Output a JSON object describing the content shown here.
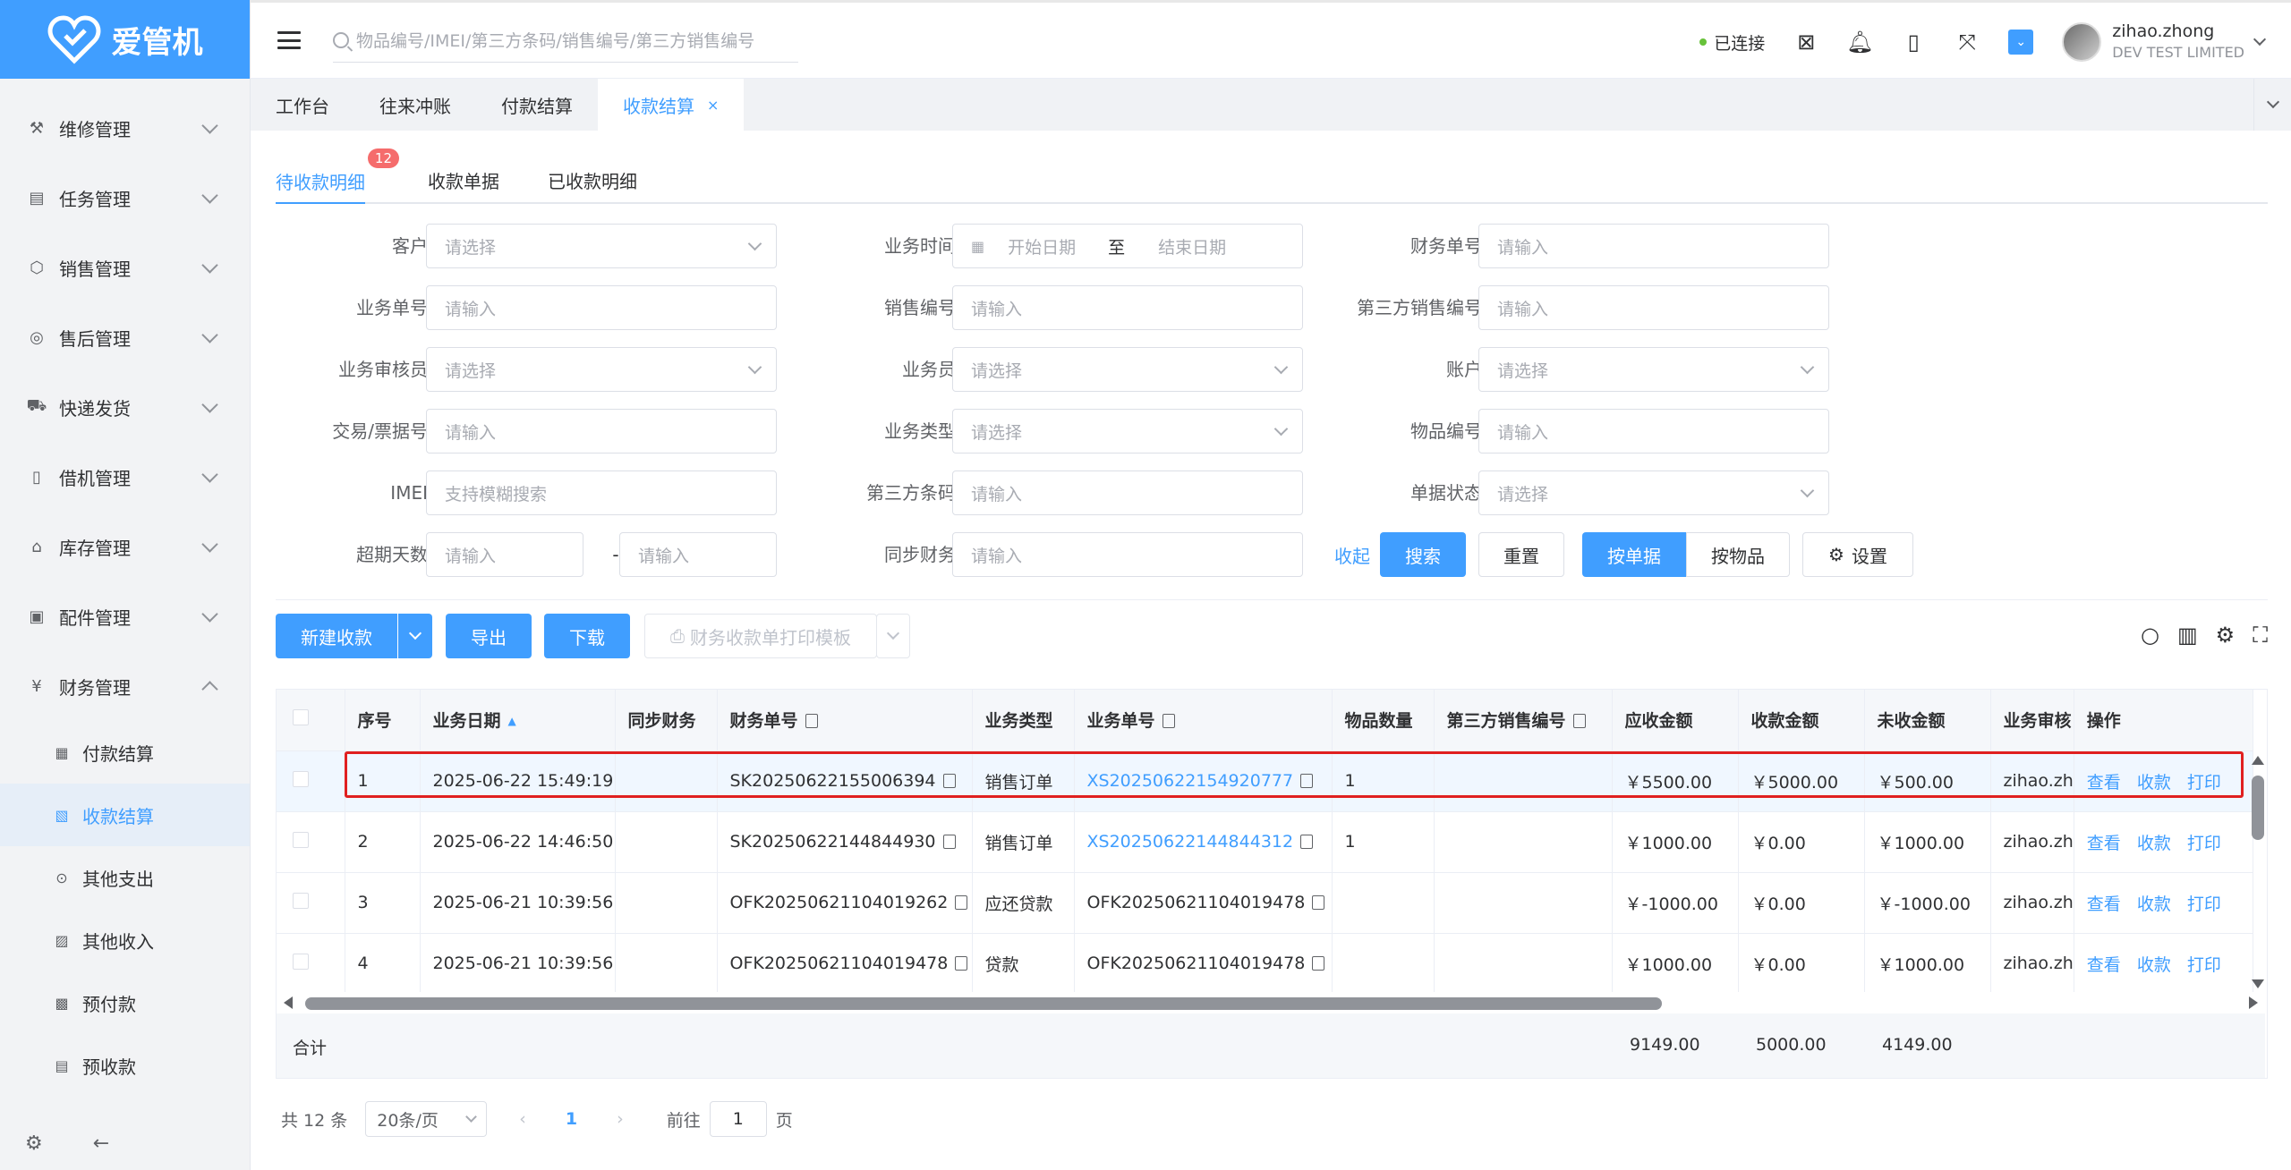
{
  "app": {
    "logo_text": "爱管机"
  },
  "sidebar": {
    "items": [
      {
        "label": "维修管理",
        "icon": "wrench-icon"
      },
      {
        "label": "任务管理",
        "icon": "task-icon"
      },
      {
        "label": "销售管理",
        "icon": "box-icon"
      },
      {
        "label": "售后管理",
        "icon": "service-icon"
      },
      {
        "label": "快递发货",
        "icon": "truck-icon"
      },
      {
        "label": "借机管理",
        "icon": "phone-icon"
      },
      {
        "label": "库存管理",
        "icon": "warehouse-icon"
      },
      {
        "label": "配件管理",
        "icon": "parts-icon"
      },
      {
        "label": "财务管理",
        "icon": "yen-icon"
      }
    ],
    "subitems": [
      {
        "label": "付款结算",
        "icon": "pay-icon"
      },
      {
        "label": "收款结算",
        "icon": "receipt-icon"
      },
      {
        "label": "其他支出",
        "icon": "expense-icon"
      },
      {
        "label": "其他收入",
        "icon": "income-icon"
      },
      {
        "label": "预付款",
        "icon": "prepay-icon"
      },
      {
        "label": "预收款",
        "icon": "prereceive-icon"
      }
    ]
  },
  "header": {
    "search_placeholder": "物品编号/IMEI/第三方条码/销售编号/第三方销售编号",
    "status": "已连接",
    "user_name": "zihao.zhong",
    "company": "DEV TEST LIMITED"
  },
  "tabs": [
    "工作台",
    "往来冲账",
    "付款结算",
    "收款结算"
  ],
  "subtabs": [
    {
      "label": "待收款明细",
      "badge": "12"
    },
    {
      "label": "收款单据"
    },
    {
      "label": "已收款明细"
    }
  ],
  "form": {
    "customer": {
      "label": "客户",
      "placeholder": "请选择"
    },
    "biz_time": {
      "label": "业务时间",
      "start": "开始日期",
      "sep": "至",
      "end": "结束日期"
    },
    "fin_no": {
      "label": "财务单号",
      "placeholder": "请输入"
    },
    "biz_no": {
      "label": "业务单号",
      "placeholder": "请输入"
    },
    "sale_no": {
      "label": "销售编号",
      "placeholder": "请输入"
    },
    "third_sale_no": {
      "label": "第三方销售编号",
      "placeholder": "请输入"
    },
    "auditor": {
      "label": "业务审核员",
      "placeholder": "请选择"
    },
    "salesman": {
      "label": "业务员",
      "placeholder": "请选择"
    },
    "account": {
      "label": "账户",
      "placeholder": "请选择"
    },
    "trade_no": {
      "label": "交易/票据号",
      "placeholder": "请输入"
    },
    "biz_type": {
      "label": "业务类型",
      "placeholder": "请选择"
    },
    "item_no": {
      "label": "物品编号",
      "placeholder": "请输入"
    },
    "imei": {
      "label": "IMEI",
      "placeholder": "支持模糊搜索"
    },
    "third_barcode": {
      "label": "第三方条码",
      "placeholder": "请输入"
    },
    "doc_status": {
      "label": "单据状态",
      "placeholder": "请选择"
    },
    "overdue": {
      "label": "超期天数",
      "placeholder1": "请输入",
      "sep": "-",
      "placeholder2": "请输入"
    },
    "sync": {
      "label": "同步财务",
      "placeholder": "请输入"
    },
    "collapse": "收起",
    "search": "搜索",
    "reset": "重置",
    "by_doc": "按单据",
    "by_item": "按物品",
    "settings": "设置"
  },
  "toolbar": {
    "new": "新建收款",
    "export": "导出",
    "download": "下载",
    "print_template": "财务收款单打印模板"
  },
  "table": {
    "headers": [
      "序号",
      "业务日期",
      "同步财务",
      "财务单号",
      "业务类型",
      "业务单号",
      "物品数量",
      "第三方销售编号",
      "应收金额",
      "收款金额",
      "未收金额",
      "业务审核",
      "操作"
    ],
    "rows": [
      {
        "no": "1",
        "date": "2025-06-22 15:49:19",
        "sync": "",
        "fin": "SK20250622155006394",
        "type": "销售订单",
        "biz": "XS20250622154920777",
        "biz_link": true,
        "qty": "1",
        "third": "",
        "due": "￥5500.00",
        "recv": "￥5000.00",
        "left": "￥500.00",
        "auditor": "zihao.zh"
      },
      {
        "no": "2",
        "date": "2025-06-22 14:46:50",
        "sync": "",
        "fin": "SK20250622144844930",
        "type": "销售订单",
        "biz": "XS20250622144844312",
        "biz_link": true,
        "qty": "1",
        "third": "",
        "due": "￥1000.00",
        "recv": "￥0.00",
        "left": "￥1000.00",
        "auditor": "zihao.zh"
      },
      {
        "no": "3",
        "date": "2025-06-21 10:39:56",
        "sync": "",
        "fin": "OFK20250621104019262",
        "type": "应还贷款",
        "biz": "OFK20250621104019478",
        "biz_link": false,
        "qty": "",
        "third": "",
        "due": "￥-1000.00",
        "recv": "￥0.00",
        "left": "￥-1000.00",
        "auditor": "zihao.zh"
      },
      {
        "no": "4",
        "date": "2025-06-21 10:39:56",
        "sync": "",
        "fin": "OFK20250621104019478",
        "type": "贷款",
        "biz": "OFK20250621104019478",
        "biz_link": false,
        "qty": "",
        "third": "",
        "due": "￥1000.00",
        "recv": "￥0.00",
        "left": "￥1000.00",
        "auditor": "zihao.zh"
      }
    ],
    "ops": [
      "查看",
      "收款",
      "打印"
    ],
    "sum_label": "合计",
    "sum_due": "9149.00",
    "sum_recv": "5000.00",
    "sum_left": "4149.00"
  },
  "pager": {
    "total": "共 12 条",
    "page_size": "20条/页",
    "current": "1",
    "goto": "前往",
    "goto_value": "1",
    "page_unit": "页"
  },
  "colors": {
    "primary": "#409eff",
    "danger": "#f56c6c",
    "highlight": "#e02020"
  }
}
